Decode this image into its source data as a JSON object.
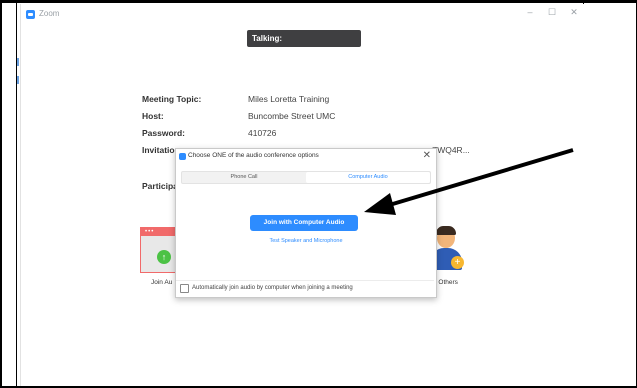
{
  "window": {
    "app_title": "Zoom",
    "controls": {
      "minimize": "–",
      "maximize": "☐",
      "close": "✕"
    }
  },
  "talking_label": "Talking:",
  "meeting_info": [
    {
      "label": "Meeting Topic:",
      "value": "Miles Loretta Training"
    },
    {
      "label": "Host:",
      "value": "Buncombe Street UMC"
    },
    {
      "label": "Password:",
      "value": "410726"
    },
    {
      "label": "Invitation",
      "value": "ZWQ4R..."
    }
  ],
  "participants_label": "Participa",
  "background_icons": {
    "join_audio_label": "Join Au",
    "invite_label": "e Others"
  },
  "audio_dialog": {
    "title": "Choose ONE of the audio conference options",
    "close": "✕",
    "tabs": [
      {
        "label": "Phone Call",
        "selected": false
      },
      {
        "label": "Computer Audio",
        "selected": true
      }
    ],
    "join_button": "Join with Computer Audio",
    "test_link": "Test Speaker and Microphone",
    "auto_join_checkbox": {
      "label": "Automatically join audio by computer when joining a meeting",
      "checked": false
    }
  },
  "colors": {
    "accent": "#2d8cff",
    "talking_bg": "#3f3f41",
    "arrow": "#000000"
  }
}
